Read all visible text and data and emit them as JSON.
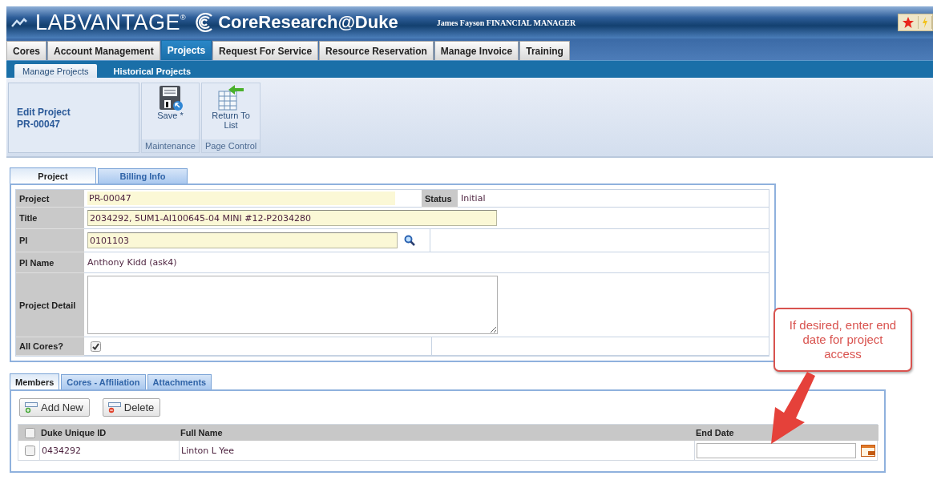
{
  "header": {
    "brand": "LABVANTAGE",
    "registered": "®",
    "app_title": "CoreResearch@Duke",
    "user": "James Fayson FINANCIAL MANAGER"
  },
  "main_tabs": [
    {
      "label": "Cores",
      "selected": false
    },
    {
      "label": "Account Management",
      "selected": false
    },
    {
      "label": "Projects",
      "selected": true
    },
    {
      "label": "Request For Service",
      "selected": false
    },
    {
      "label": "Resource Reservation",
      "selected": false
    },
    {
      "label": "Manage Invoice",
      "selected": false
    },
    {
      "label": "Training",
      "selected": false
    }
  ],
  "sub_tabs": [
    {
      "label": "Manage Projects",
      "selected": true
    },
    {
      "label": "Historical Projects",
      "selected": false
    }
  ],
  "ribbon": {
    "title": "Edit Project",
    "record_id": "PR-00047",
    "groups": [
      {
        "label": "Maintenance",
        "buttons": [
          {
            "label": "Save *",
            "kind": "save"
          }
        ]
      },
      {
        "label": "Page Control",
        "buttons": [
          {
            "label": "Return To List",
            "kind": "return"
          }
        ]
      }
    ]
  },
  "form_tabs": [
    {
      "label": "Project",
      "selected": true
    },
    {
      "label": "Billing Info",
      "selected": false
    }
  ],
  "form": {
    "rows": [
      {
        "label": "Project",
        "kind": "readonly",
        "value": "PR-00047",
        "side_label": "Status",
        "side_value": "Initial"
      },
      {
        "label": "Title",
        "kind": "input",
        "value": "2034292, 5UM1-AI100645-04 MINI #12-P2034280"
      },
      {
        "label": "PI",
        "kind": "lookup",
        "value": "0101103"
      },
      {
        "label": "PI Name",
        "kind": "text",
        "value": "Anthony Kidd (ask4)"
      },
      {
        "label": "Project Detail",
        "kind": "textarea"
      },
      {
        "label": "All Cores?",
        "kind": "checkbox",
        "checked": true
      }
    ]
  },
  "member_tabs": [
    {
      "label": "Members",
      "selected": true
    },
    {
      "label": "Cores - Affiliation",
      "selected": false
    },
    {
      "label": "Attachments",
      "selected": false
    }
  ],
  "members": {
    "buttons": [
      {
        "label": "Add New",
        "kind": "add"
      },
      {
        "label": "Delete",
        "kind": "delete"
      }
    ],
    "columns": [
      "Duke Unique ID",
      "Full Name",
      "End Date"
    ],
    "all_checked": false,
    "rows": [
      {
        "checked": false,
        "duke_unique_id": "0434292",
        "full_name": "Linton L Yee"
      }
    ]
  },
  "callout": {
    "text": "If desired, enter end date for project access"
  }
}
